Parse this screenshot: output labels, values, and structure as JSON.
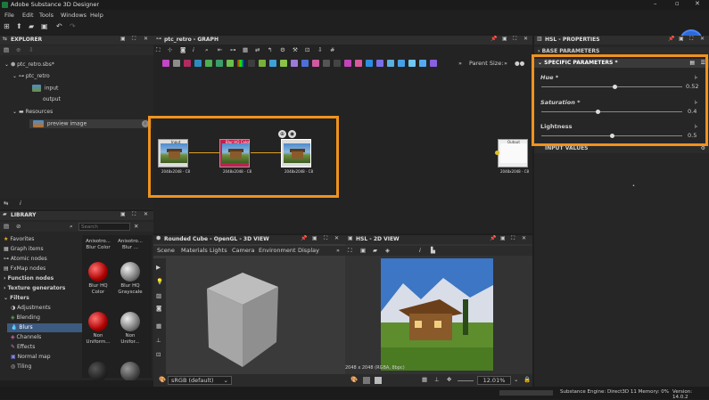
{
  "app_title": "Adobe Substance 3D Designer",
  "menu": [
    "File",
    "Edit",
    "Tools",
    "Windows",
    "Help"
  ],
  "explorer": {
    "title": "EXPLORER",
    "tree": [
      {
        "label": "ptc_retro.sbs*"
      },
      {
        "label": "ptc_retro"
      },
      {
        "label": "input"
      },
      {
        "label": "output"
      },
      {
        "label": "Resources"
      },
      {
        "label": "preview image"
      }
    ]
  },
  "graph": {
    "title": "ptc_retro - GRAPH",
    "parent_size": "Parent Size:",
    "nodes": [
      {
        "top": "Input",
        "size": "2048x2048 - C8"
      },
      {
        "top": "Blur HQ Color",
        "size": "2048x2048 - C8"
      },
      {
        "top": "",
        "size": "2048x2048 - C8"
      },
      {
        "top": "Output",
        "size": "2048x2048 - C8"
      }
    ]
  },
  "library": {
    "title": "LIBRARY",
    "search_placeholder": "Search",
    "categories": [
      "Favorites",
      "Graph items",
      "Atomic nodes",
      "FxMap nodes",
      "Function nodes",
      "Texture generators",
      "Filters",
      "Adjustments",
      "Blending",
      "Blurs",
      "Channels",
      "Effects",
      "Normal map",
      "Tiling"
    ],
    "items": [
      "Anisotro... Blur Color",
      "Anisotro... Blur ...",
      "Blur HQ Color",
      "Blur HQ Grayscale",
      "Non Uniform...",
      "Non Unifor..."
    ]
  },
  "view3d": {
    "title": "Rounded Cube - OpenGL - 3D VIEW",
    "menu": [
      "Scene",
      "Materials",
      "Lights",
      "Camera",
      "Environment",
      "Display"
    ],
    "colorspace": "sRGB (default)"
  },
  "view2d": {
    "title": "HSL - 2D VIEW",
    "info": "2048 x 2048 (RGBA, 8bpc)",
    "zoom": "12.01%"
  },
  "properties": {
    "title": "HSL - PROPERTIES",
    "base": "BASE PARAMETERS",
    "specific": "SPECIFIC PARAMETERS *",
    "input_values": "INPUT VALUES",
    "params": [
      {
        "label": "Hue *",
        "value": "0.52",
        "fraction": 0.52
      },
      {
        "label": "Saturation *",
        "value": "0.4",
        "fraction": 0.4
      },
      {
        "label": "Lightness",
        "value": "0.5",
        "fraction": 0.5
      }
    ]
  },
  "status": {
    "engine": "Substance Engine: Direct3D 11 Memory: 0%",
    "version": "Version: 14.0.2"
  }
}
